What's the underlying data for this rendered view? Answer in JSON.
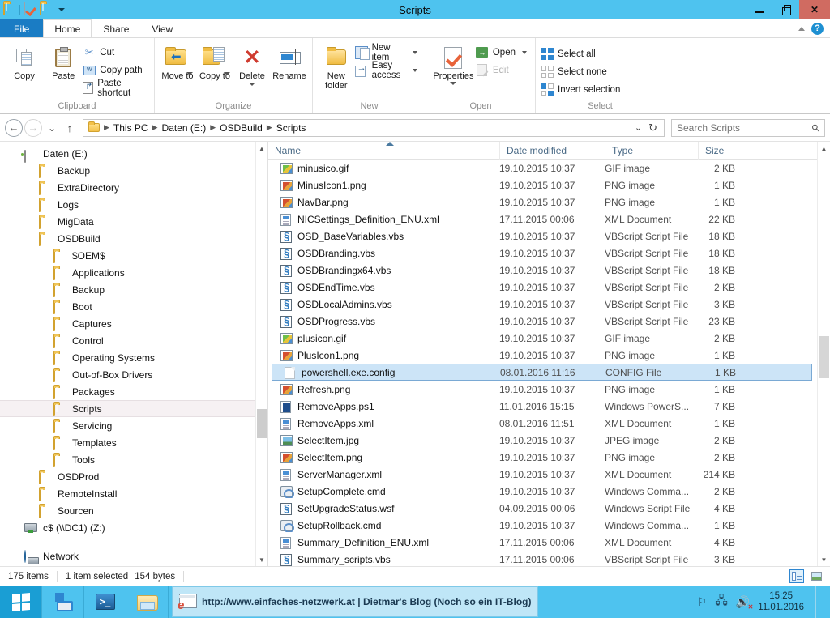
{
  "window": {
    "title": "Scripts",
    "quick_access": [
      "folder-icon",
      "properties-icon",
      "new-folder-icon",
      "customize-caret-icon"
    ],
    "caption": {
      "minimize": "minimize-icon",
      "maximize": "maximize-icon",
      "close": "✕"
    }
  },
  "ribbon": {
    "tabs": [
      {
        "label": "File",
        "type": "file"
      },
      {
        "label": "Home",
        "type": "active"
      },
      {
        "label": "Share",
        "type": "normal"
      },
      {
        "label": "View",
        "type": "normal"
      }
    ],
    "collapse_label": "^",
    "help_label": "?",
    "groups": [
      {
        "label": "Clipboard",
        "big": [
          {
            "label": "Copy",
            "icon": "copy-icon"
          },
          {
            "label": "Paste",
            "icon": "paste-icon"
          }
        ],
        "small": [
          {
            "label": "Cut",
            "icon": "scissors-icon"
          },
          {
            "label": "Copy path",
            "icon": "copy-path-icon"
          },
          {
            "label": "Paste shortcut",
            "icon": "paste-shortcut-icon"
          }
        ]
      },
      {
        "label": "Organize",
        "big": [
          {
            "label": "Move to",
            "icon": "move-to-icon"
          },
          {
            "label": "Copy to",
            "icon": "copy-to-icon"
          },
          {
            "label": "Delete",
            "icon": "delete-icon"
          },
          {
            "label": "Rename",
            "icon": "rename-icon"
          }
        ],
        "small": []
      },
      {
        "label": "New",
        "big": [
          {
            "label": "New folder",
            "icon": "new-folder-icon"
          }
        ],
        "small": [
          {
            "label": "New item",
            "icon": "new-item-icon"
          },
          {
            "label": "Easy access",
            "icon": "easy-access-icon"
          }
        ]
      },
      {
        "label": "Open",
        "big": [
          {
            "label": "Properties",
            "icon": "properties-icon"
          }
        ],
        "small": [
          {
            "label": "Open",
            "icon": "open-icon"
          },
          {
            "label": "Edit",
            "icon": "edit-icon",
            "disabled": true
          }
        ]
      },
      {
        "label": "Select",
        "big": [],
        "small": [
          {
            "label": "Select all",
            "icon": "select-all-icon"
          },
          {
            "label": "Select none",
            "icon": "select-none-icon"
          },
          {
            "label": "Invert selection",
            "icon": "invert-selection-icon"
          }
        ]
      }
    ]
  },
  "addressbar": {
    "back": "back-icon",
    "forward": "forward-icon",
    "recent": "recent-locations-caret-icon",
    "up": "up-icon",
    "breadcrumbs": [
      "This PC",
      "Daten (E:)",
      "OSDBuild",
      "Scripts"
    ],
    "dropdown": "⌄",
    "refresh": "↻",
    "search": {
      "placeholder": "Search Scripts",
      "value": "",
      "icon": "search-icon"
    }
  },
  "navpane": {
    "items": [
      {
        "label": "Daten (E:)",
        "indent": 0,
        "icon": "drive-icon"
      },
      {
        "label": "Backup",
        "indent": 1,
        "icon": "folder-icon"
      },
      {
        "label": "ExtraDirectory",
        "indent": 1,
        "icon": "folder-icon"
      },
      {
        "label": "Logs",
        "indent": 1,
        "icon": "folder-icon"
      },
      {
        "label": "MigData",
        "indent": 1,
        "icon": "folder-icon"
      },
      {
        "label": "OSDBuild",
        "indent": 1,
        "icon": "folder-icon"
      },
      {
        "label": "$OEM$",
        "indent": 2,
        "icon": "folder-icon"
      },
      {
        "label": "Applications",
        "indent": 2,
        "icon": "folder-icon"
      },
      {
        "label": "Backup",
        "indent": 2,
        "icon": "folder-icon"
      },
      {
        "label": "Boot",
        "indent": 2,
        "icon": "folder-icon"
      },
      {
        "label": "Captures",
        "indent": 2,
        "icon": "folder-icon"
      },
      {
        "label": "Control",
        "indent": 2,
        "icon": "folder-icon"
      },
      {
        "label": "Operating Systems",
        "indent": 2,
        "icon": "folder-icon"
      },
      {
        "label": "Out-of-Box Drivers",
        "indent": 2,
        "icon": "folder-icon"
      },
      {
        "label": "Packages",
        "indent": 2,
        "icon": "folder-icon"
      },
      {
        "label": "Scripts",
        "indent": 2,
        "icon": "folder-icon",
        "selected": true
      },
      {
        "label": "Servicing",
        "indent": 2,
        "icon": "folder-icon"
      },
      {
        "label": "Templates",
        "indent": 2,
        "icon": "folder-icon"
      },
      {
        "label": "Tools",
        "indent": 2,
        "icon": "folder-icon"
      },
      {
        "label": "OSDProd",
        "indent": 1,
        "icon": "folder-icon"
      },
      {
        "label": "RemoteInstall",
        "indent": 1,
        "icon": "folder-icon"
      },
      {
        "label": "Sourcen",
        "indent": 1,
        "icon": "folder-icon"
      },
      {
        "label": "c$ (\\\\DC1) (Z:)",
        "indent": 0,
        "icon": "network-drive-icon"
      },
      {
        "label": "",
        "indent": 0,
        "icon": "spacer"
      },
      {
        "label": "Network",
        "indent": 0,
        "icon": "network-icon"
      }
    ]
  },
  "filelist": {
    "columns": [
      {
        "label": "Name",
        "sorted": "asc"
      },
      {
        "label": "Date modified"
      },
      {
        "label": "Type"
      },
      {
        "label": "Size"
      }
    ],
    "rows": [
      {
        "name": "minusico.gif",
        "date": "19.10.2015 10:37",
        "type": "GIF image",
        "size": "2 KB",
        "icon": "gif-file-icon"
      },
      {
        "name": "MinusIcon1.png",
        "date": "19.10.2015 10:37",
        "type": "PNG image",
        "size": "1 KB",
        "icon": "png-file-icon"
      },
      {
        "name": "NavBar.png",
        "date": "19.10.2015 10:37",
        "type": "PNG image",
        "size": "1 KB",
        "icon": "png-file-icon"
      },
      {
        "name": "NICSettings_Definition_ENU.xml",
        "date": "17.11.2015 00:06",
        "type": "XML Document",
        "size": "22 KB",
        "icon": "xml-file-icon"
      },
      {
        "name": "OSD_BaseVariables.vbs",
        "date": "19.10.2015 10:37",
        "type": "VBScript Script File",
        "size": "18 KB",
        "icon": "vbs-file-icon"
      },
      {
        "name": "OSDBranding.vbs",
        "date": "19.10.2015 10:37",
        "type": "VBScript Script File",
        "size": "18 KB",
        "icon": "vbs-file-icon"
      },
      {
        "name": "OSDBrandingx64.vbs",
        "date": "19.10.2015 10:37",
        "type": "VBScript Script File",
        "size": "18 KB",
        "icon": "vbs-file-icon"
      },
      {
        "name": "OSDEndTime.vbs",
        "date": "19.10.2015 10:37",
        "type": "VBScript Script File",
        "size": "2 KB",
        "icon": "vbs-file-icon"
      },
      {
        "name": "OSDLocalAdmins.vbs",
        "date": "19.10.2015 10:37",
        "type": "VBScript Script File",
        "size": "3 KB",
        "icon": "vbs-file-icon"
      },
      {
        "name": "OSDProgress.vbs",
        "date": "19.10.2015 10:37",
        "type": "VBScript Script File",
        "size": "23 KB",
        "icon": "vbs-file-icon"
      },
      {
        "name": "plusicon.gif",
        "date": "19.10.2015 10:37",
        "type": "GIF image",
        "size": "2 KB",
        "icon": "gif-file-icon"
      },
      {
        "name": "PlusIcon1.png",
        "date": "19.10.2015 10:37",
        "type": "PNG image",
        "size": "1 KB",
        "icon": "png-file-icon"
      },
      {
        "name": "powershell.exe.config",
        "date": "08.01.2016 11:16",
        "type": "CONFIG File",
        "size": "1 KB",
        "icon": "config-file-icon",
        "selected": true
      },
      {
        "name": "Refresh.png",
        "date": "19.10.2015 10:37",
        "type": "PNG image",
        "size": "1 KB",
        "icon": "png-file-icon"
      },
      {
        "name": "RemoveApps.ps1",
        "date": "11.01.2016 15:15",
        "type": "Windows PowerS...",
        "size": "7 KB",
        "icon": "ps1-file-icon"
      },
      {
        "name": "RemoveApps.xml",
        "date": "08.01.2016 11:51",
        "type": "XML Document",
        "size": "1 KB",
        "icon": "xml-file-icon"
      },
      {
        "name": "SelectItem.jpg",
        "date": "19.10.2015 10:37",
        "type": "JPEG image",
        "size": "2 KB",
        "icon": "jpg-file-icon"
      },
      {
        "name": "SelectItem.png",
        "date": "19.10.2015 10:37",
        "type": "PNG image",
        "size": "2 KB",
        "icon": "png-file-icon"
      },
      {
        "name": "ServerManager.xml",
        "date": "19.10.2015 10:37",
        "type": "XML Document",
        "size": "214 KB",
        "icon": "xml-file-icon"
      },
      {
        "name": "SetupComplete.cmd",
        "date": "19.10.2015 10:37",
        "type": "Windows Comma...",
        "size": "2 KB",
        "icon": "cmd-file-icon"
      },
      {
        "name": "SetUpgradeStatus.wsf",
        "date": "04.09.2015 00:06",
        "type": "Windows Script File",
        "size": "4 KB",
        "icon": "vbs-file-icon"
      },
      {
        "name": "SetupRollback.cmd",
        "date": "19.10.2015 10:37",
        "type": "Windows Comma...",
        "size": "1 KB",
        "icon": "cmd-file-icon"
      },
      {
        "name": "Summary_Definition_ENU.xml",
        "date": "17.11.2015 00:06",
        "type": "XML Document",
        "size": "4 KB",
        "icon": "xml-file-icon"
      },
      {
        "name": "Summary_scripts.vbs",
        "date": "17.11.2015 00:06",
        "type": "VBScript Script File",
        "size": "3 KB",
        "icon": "vbs-file-icon"
      }
    ]
  },
  "statusbar": {
    "item_count": "175 items",
    "selection": "1 item selected",
    "selection_size": "154 bytes",
    "views": [
      {
        "name": "details-view-button",
        "active": true
      },
      {
        "name": "large-icons-view-button",
        "active": false
      }
    ]
  },
  "taskbar": {
    "start": "start-button",
    "pinned": [
      {
        "name": "server-manager-taskbar-button"
      },
      {
        "name": "powershell-taskbar-button"
      },
      {
        "name": "file-explorer-taskbar-button"
      }
    ],
    "active_task": "http://www.einfaches-netzwerk.at | Dietmar's Blog (Noch so ein IT-Blog)",
    "tray": [
      "flag-icon",
      "network-icon",
      "speaker-muted-icon"
    ],
    "clock_time": "15:25",
    "clock_date": "11.01.2016"
  },
  "colors": {
    "titlebar": "#4ec3ef",
    "file_tab": "#1a7cc4",
    "close_button": "#d06b61",
    "selection": "#cce4f7",
    "selection_border": "#7aa9d4",
    "nav_selection": "#f6f1f3",
    "column_header_text": "#4a6a86"
  }
}
